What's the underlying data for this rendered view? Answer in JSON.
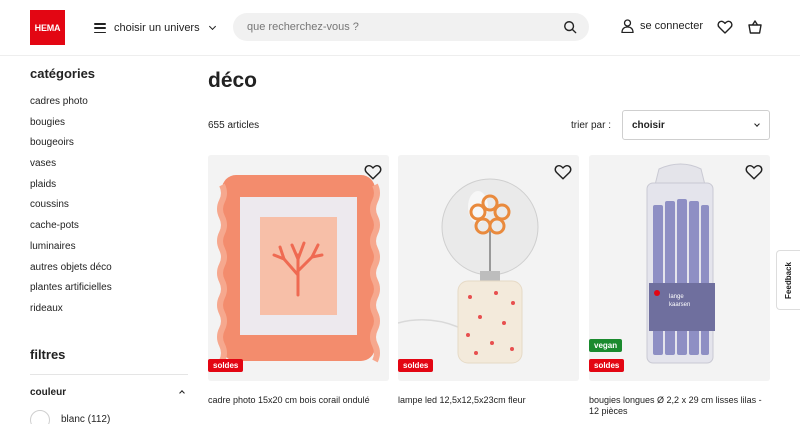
{
  "header": {
    "logo_text": "HEMA",
    "univers_label": "choisir un univers",
    "search_placeholder": "que recherchez-vous ?",
    "login_label": "se connecter",
    "brand_color": "#e30613"
  },
  "sidebar": {
    "categories_title": "catégories",
    "categories": [
      "cadres photo",
      "bougies",
      "bougeoirs",
      "vases",
      "plaids",
      "coussins",
      "cache-pots",
      "luminaires",
      "autres objets déco",
      "plantes artificielles",
      "rideaux"
    ],
    "filters_title": "filtres",
    "color_filter_label": "couleur",
    "color_options": [
      {
        "label": "blanc (112)",
        "swatch": "#ffffff"
      }
    ]
  },
  "main": {
    "title": "déco",
    "count": "655 articles",
    "sort_label": "trier par :",
    "sort_value": "choisir"
  },
  "products": [
    {
      "name": "cadre photo 15x20 cm bois corail ondulé",
      "badges": [
        "soldes"
      ]
    },
    {
      "name": "lampe led 12,5x12,5x23cm fleur",
      "badges": [
        "soldes"
      ]
    },
    {
      "name": "bougies longues Ø 2,2 x 29 cm lisses lilas - 12 pièces",
      "badges": [
        "vegan",
        "soldes"
      ]
    }
  ],
  "product_art": {
    "candle_label_lines": [
      "lange",
      "kaarsen"
    ]
  },
  "feedback_label": "Feedback"
}
